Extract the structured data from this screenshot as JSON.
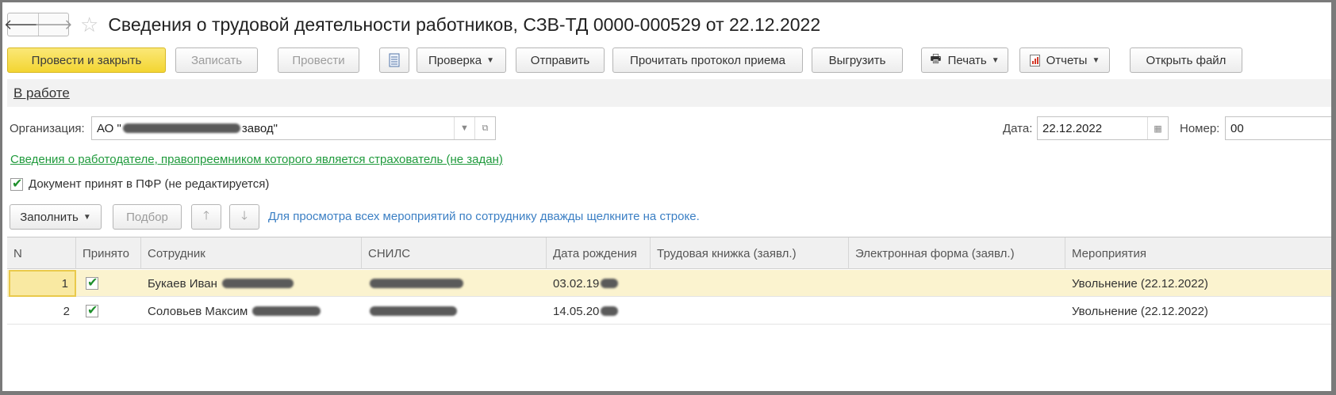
{
  "window": {
    "title": "Сведения о трудовой деятельности работников, СЗВ-ТД 0000-000529 от 22.12.2022",
    "back_icon": "arrow-left-icon",
    "forward_icon": "arrow-right-icon",
    "favorite_icon": "star-icon"
  },
  "toolbar": {
    "post_and_close": "Провести и закрыть",
    "save": "Записать",
    "post": "Провести",
    "structure_icon": "document-list-icon",
    "check": "Проверка",
    "send": "Отправить",
    "read_protocol": "Прочитать протокол приема",
    "export": "Выгрузить",
    "print": "Печать",
    "reports": "Отчеты",
    "open_file": "Открыть файл"
  },
  "status": {
    "label": "В работе"
  },
  "form": {
    "org_label": "Организация:",
    "org_value_prefix": "АО \"",
    "org_value_suffix": "завод\"",
    "date_label": "Дата:",
    "date_value": "22.12.2022",
    "number_label": "Номер:",
    "number_value": "00",
    "employer_link": "Сведения о работодателе, правопреемником которого является страхователь (не задан)",
    "accepted_checkbox_label": "Документ принят в ПФР (не редактируется)",
    "accepted_checked": true
  },
  "table_toolbar": {
    "fill": "Заполнить",
    "pick": "Подбор",
    "hint": "Для просмотра всех мероприятий по сотруднику дважды щелкните на строке."
  },
  "table": {
    "columns": [
      "N",
      "Принято",
      "Сотрудник",
      "СНИЛС",
      "Дата рождения",
      "Трудовая книжка (заявл.)",
      "Электронная форма (заявл.)",
      "Мероприятия"
    ],
    "rows": [
      {
        "n": "1",
        "accepted": true,
        "employee": "Букаев Иван",
        "snils": "",
        "birth_date": "03.02.19",
        "paper_book": "",
        "electronic_form": "",
        "events": "Увольнение (22.12.2022)",
        "selected": true
      },
      {
        "n": "2",
        "accepted": true,
        "employee": "Соловьев Максим",
        "snils": "",
        "birth_date": "14.05.20",
        "paper_book": "",
        "electronic_form": "",
        "events": "Увольнение (22.12.2022)",
        "selected": false
      }
    ]
  },
  "colors": {
    "primary_button": "#f3d532",
    "link_green": "#1f9a3c",
    "hint_blue": "#3b7fc4",
    "selected_row": "#fbf3cf"
  }
}
